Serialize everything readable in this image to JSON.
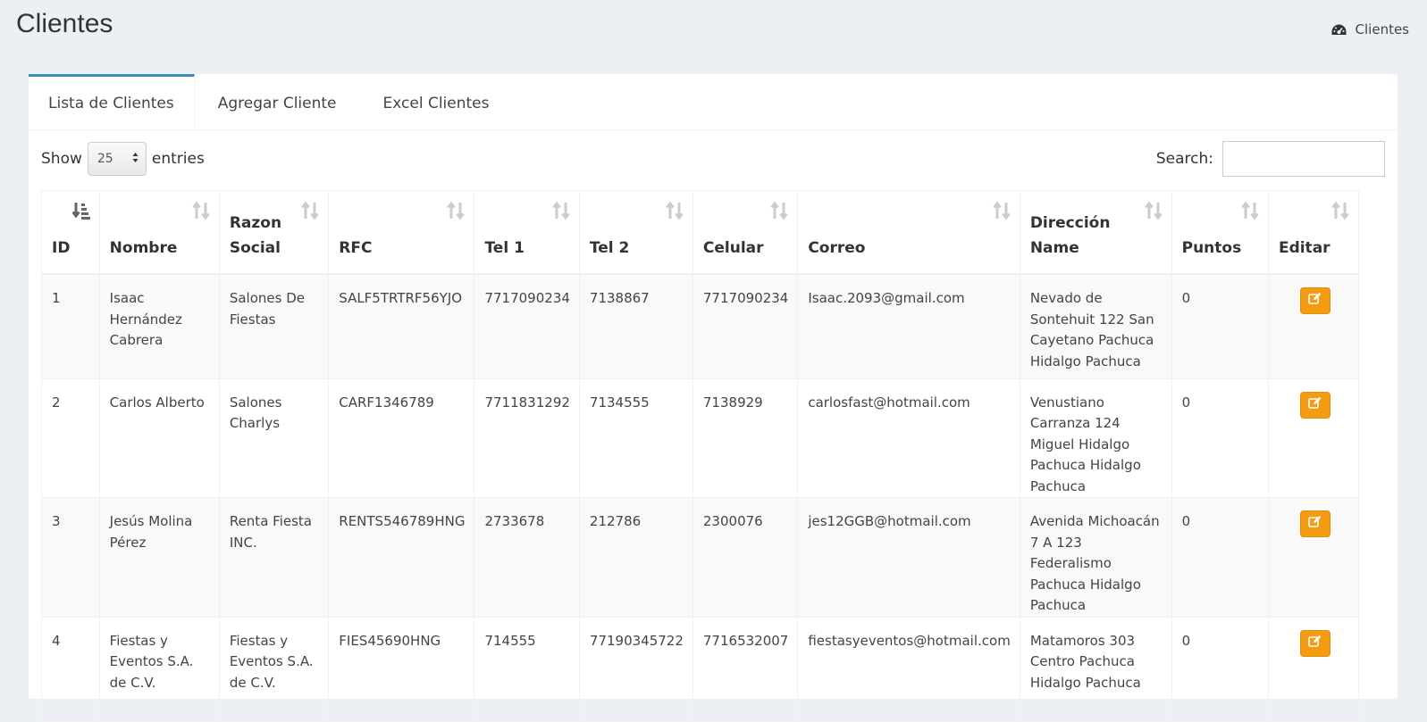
{
  "page": {
    "title": "Clientes"
  },
  "breadcrumb": {
    "label": "Clientes",
    "icon": "dashboard-icon"
  },
  "tabs": [
    {
      "label": "Lista de Clientes",
      "active": true
    },
    {
      "label": "Agregar Cliente",
      "active": false
    },
    {
      "label": "Excel Clientes",
      "active": false
    }
  ],
  "controls": {
    "show_label": "Show",
    "entries_value": "25",
    "entries_label": "entries",
    "search_label": "Search:",
    "search_value": ""
  },
  "table": {
    "headers": [
      {
        "line1": "",
        "line2": "ID"
      },
      {
        "line1": "",
        "line2": "Nombre"
      },
      {
        "line1": "Razon",
        "line2": "Social"
      },
      {
        "line1": "",
        "line2": "RFC"
      },
      {
        "line1": "",
        "line2": "Tel 1"
      },
      {
        "line1": "",
        "line2": "Tel 2"
      },
      {
        "line1": "",
        "line2": "Celular"
      },
      {
        "line1": "",
        "line2": "Correo"
      },
      {
        "line1": "Dirección",
        "line2": "Name"
      },
      {
        "line1": "",
        "line2": "Puntos"
      },
      {
        "line1": "",
        "line2": "Editar"
      }
    ],
    "rows": [
      {
        "id": "1",
        "nombre": "Isaac Hernández Cabrera",
        "razon": "Salones De Fiestas",
        "rfc": "SALF5TRTRF56YJO",
        "tel1": "7717090234",
        "tel2": "7138867",
        "celular": "7717090234",
        "correo": "Isaac.2093@gmail.com",
        "direccion": "Nevado de Sontehuit 122 San Cayetano Pachuca Hidalgo Pachuca",
        "puntos": "0"
      },
      {
        "id": "2",
        "nombre": "Carlos Alberto",
        "razon": "Salones Charlys",
        "rfc": "CARF1346789",
        "tel1": "7711831292",
        "tel2": "7134555",
        "celular": "7138929",
        "correo": "carlosfast@hotmail.com",
        "direccion": "Venustiano Carranza 124 Miguel Hidalgo Pachuca Hidalgo Pachuca",
        "puntos": "0"
      },
      {
        "id": "3",
        "nombre": "Jesús Molina Pérez",
        "razon": "Renta Fiesta INC.",
        "rfc": "RENTS546789HNG",
        "tel1": "2733678",
        "tel2": "212786",
        "celular": "2300076",
        "correo": "jes12GGB@hotmail.com",
        "direccion": "Avenida Michoacán 7 A 123 Federalismo Pachuca Hidalgo Pachuca",
        "puntos": "0"
      },
      {
        "id": "4",
        "nombre": "Fiestas y Eventos S.A. de C.V.",
        "razon": "Fiestas y Eventos S.A. de C.V.",
        "rfc": "FIES45690HNG",
        "tel1": "714555",
        "tel2": "77190345722",
        "celular": "7716532007",
        "correo": "fiestasyeventos@hotmail.com",
        "direccion": "Matamoros 303 Centro Pachuca Hidalgo Pachuca",
        "puntos": "0"
      }
    ]
  },
  "colors": {
    "accent": "#3c8dbc",
    "edit_button": "#f39c12",
    "background": "#ecf0f5"
  }
}
